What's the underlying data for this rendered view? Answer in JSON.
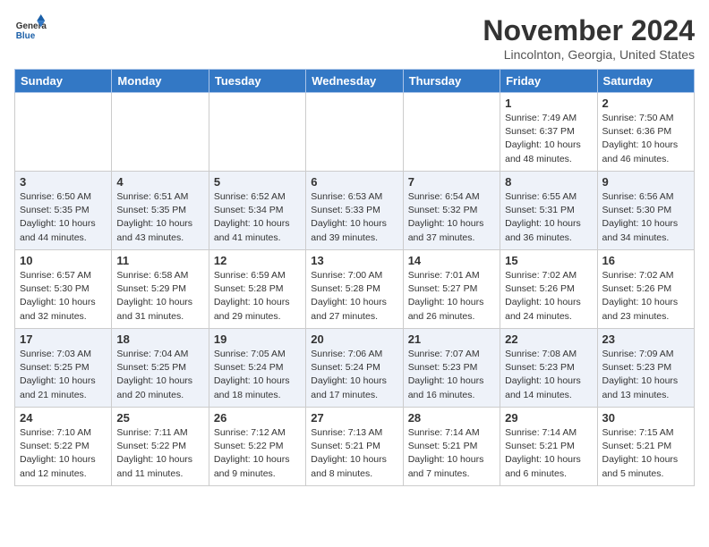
{
  "header": {
    "logo_general": "General",
    "logo_blue": "Blue",
    "month": "November 2024",
    "location": "Lincolnton, Georgia, United States"
  },
  "days_of_week": [
    "Sunday",
    "Monday",
    "Tuesday",
    "Wednesday",
    "Thursday",
    "Friday",
    "Saturday"
  ],
  "weeks": [
    [
      {
        "day": "",
        "content": ""
      },
      {
        "day": "",
        "content": ""
      },
      {
        "day": "",
        "content": ""
      },
      {
        "day": "",
        "content": ""
      },
      {
        "day": "",
        "content": ""
      },
      {
        "day": "1",
        "content": "Sunrise: 7:49 AM\nSunset: 6:37 PM\nDaylight: 10 hours\nand 48 minutes."
      },
      {
        "day": "2",
        "content": "Sunrise: 7:50 AM\nSunset: 6:36 PM\nDaylight: 10 hours\nand 46 minutes."
      }
    ],
    [
      {
        "day": "3",
        "content": "Sunrise: 6:50 AM\nSunset: 5:35 PM\nDaylight: 10 hours\nand 44 minutes."
      },
      {
        "day": "4",
        "content": "Sunrise: 6:51 AM\nSunset: 5:35 PM\nDaylight: 10 hours\nand 43 minutes."
      },
      {
        "day": "5",
        "content": "Sunrise: 6:52 AM\nSunset: 5:34 PM\nDaylight: 10 hours\nand 41 minutes."
      },
      {
        "day": "6",
        "content": "Sunrise: 6:53 AM\nSunset: 5:33 PM\nDaylight: 10 hours\nand 39 minutes."
      },
      {
        "day": "7",
        "content": "Sunrise: 6:54 AM\nSunset: 5:32 PM\nDaylight: 10 hours\nand 37 minutes."
      },
      {
        "day": "8",
        "content": "Sunrise: 6:55 AM\nSunset: 5:31 PM\nDaylight: 10 hours\nand 36 minutes."
      },
      {
        "day": "9",
        "content": "Sunrise: 6:56 AM\nSunset: 5:30 PM\nDaylight: 10 hours\nand 34 minutes."
      }
    ],
    [
      {
        "day": "10",
        "content": "Sunrise: 6:57 AM\nSunset: 5:30 PM\nDaylight: 10 hours\nand 32 minutes."
      },
      {
        "day": "11",
        "content": "Sunrise: 6:58 AM\nSunset: 5:29 PM\nDaylight: 10 hours\nand 31 minutes."
      },
      {
        "day": "12",
        "content": "Sunrise: 6:59 AM\nSunset: 5:28 PM\nDaylight: 10 hours\nand 29 minutes."
      },
      {
        "day": "13",
        "content": "Sunrise: 7:00 AM\nSunset: 5:28 PM\nDaylight: 10 hours\nand 27 minutes."
      },
      {
        "day": "14",
        "content": "Sunrise: 7:01 AM\nSunset: 5:27 PM\nDaylight: 10 hours\nand 26 minutes."
      },
      {
        "day": "15",
        "content": "Sunrise: 7:02 AM\nSunset: 5:26 PM\nDaylight: 10 hours\nand 24 minutes."
      },
      {
        "day": "16",
        "content": "Sunrise: 7:02 AM\nSunset: 5:26 PM\nDaylight: 10 hours\nand 23 minutes."
      }
    ],
    [
      {
        "day": "17",
        "content": "Sunrise: 7:03 AM\nSunset: 5:25 PM\nDaylight: 10 hours\nand 21 minutes."
      },
      {
        "day": "18",
        "content": "Sunrise: 7:04 AM\nSunset: 5:25 PM\nDaylight: 10 hours\nand 20 minutes."
      },
      {
        "day": "19",
        "content": "Sunrise: 7:05 AM\nSunset: 5:24 PM\nDaylight: 10 hours\nand 18 minutes."
      },
      {
        "day": "20",
        "content": "Sunrise: 7:06 AM\nSunset: 5:24 PM\nDaylight: 10 hours\nand 17 minutes."
      },
      {
        "day": "21",
        "content": "Sunrise: 7:07 AM\nSunset: 5:23 PM\nDaylight: 10 hours\nand 16 minutes."
      },
      {
        "day": "22",
        "content": "Sunrise: 7:08 AM\nSunset: 5:23 PM\nDaylight: 10 hours\nand 14 minutes."
      },
      {
        "day": "23",
        "content": "Sunrise: 7:09 AM\nSunset: 5:23 PM\nDaylight: 10 hours\nand 13 minutes."
      }
    ],
    [
      {
        "day": "24",
        "content": "Sunrise: 7:10 AM\nSunset: 5:22 PM\nDaylight: 10 hours\nand 12 minutes."
      },
      {
        "day": "25",
        "content": "Sunrise: 7:11 AM\nSunset: 5:22 PM\nDaylight: 10 hours\nand 11 minutes."
      },
      {
        "day": "26",
        "content": "Sunrise: 7:12 AM\nSunset: 5:22 PM\nDaylight: 10 hours\nand 9 minutes."
      },
      {
        "day": "27",
        "content": "Sunrise: 7:13 AM\nSunset: 5:21 PM\nDaylight: 10 hours\nand 8 minutes."
      },
      {
        "day": "28",
        "content": "Sunrise: 7:14 AM\nSunset: 5:21 PM\nDaylight: 10 hours\nand 7 minutes."
      },
      {
        "day": "29",
        "content": "Sunrise: 7:14 AM\nSunset: 5:21 PM\nDaylight: 10 hours\nand 6 minutes."
      },
      {
        "day": "30",
        "content": "Sunrise: 7:15 AM\nSunset: 5:21 PM\nDaylight: 10 hours\nand 5 minutes."
      }
    ]
  ]
}
